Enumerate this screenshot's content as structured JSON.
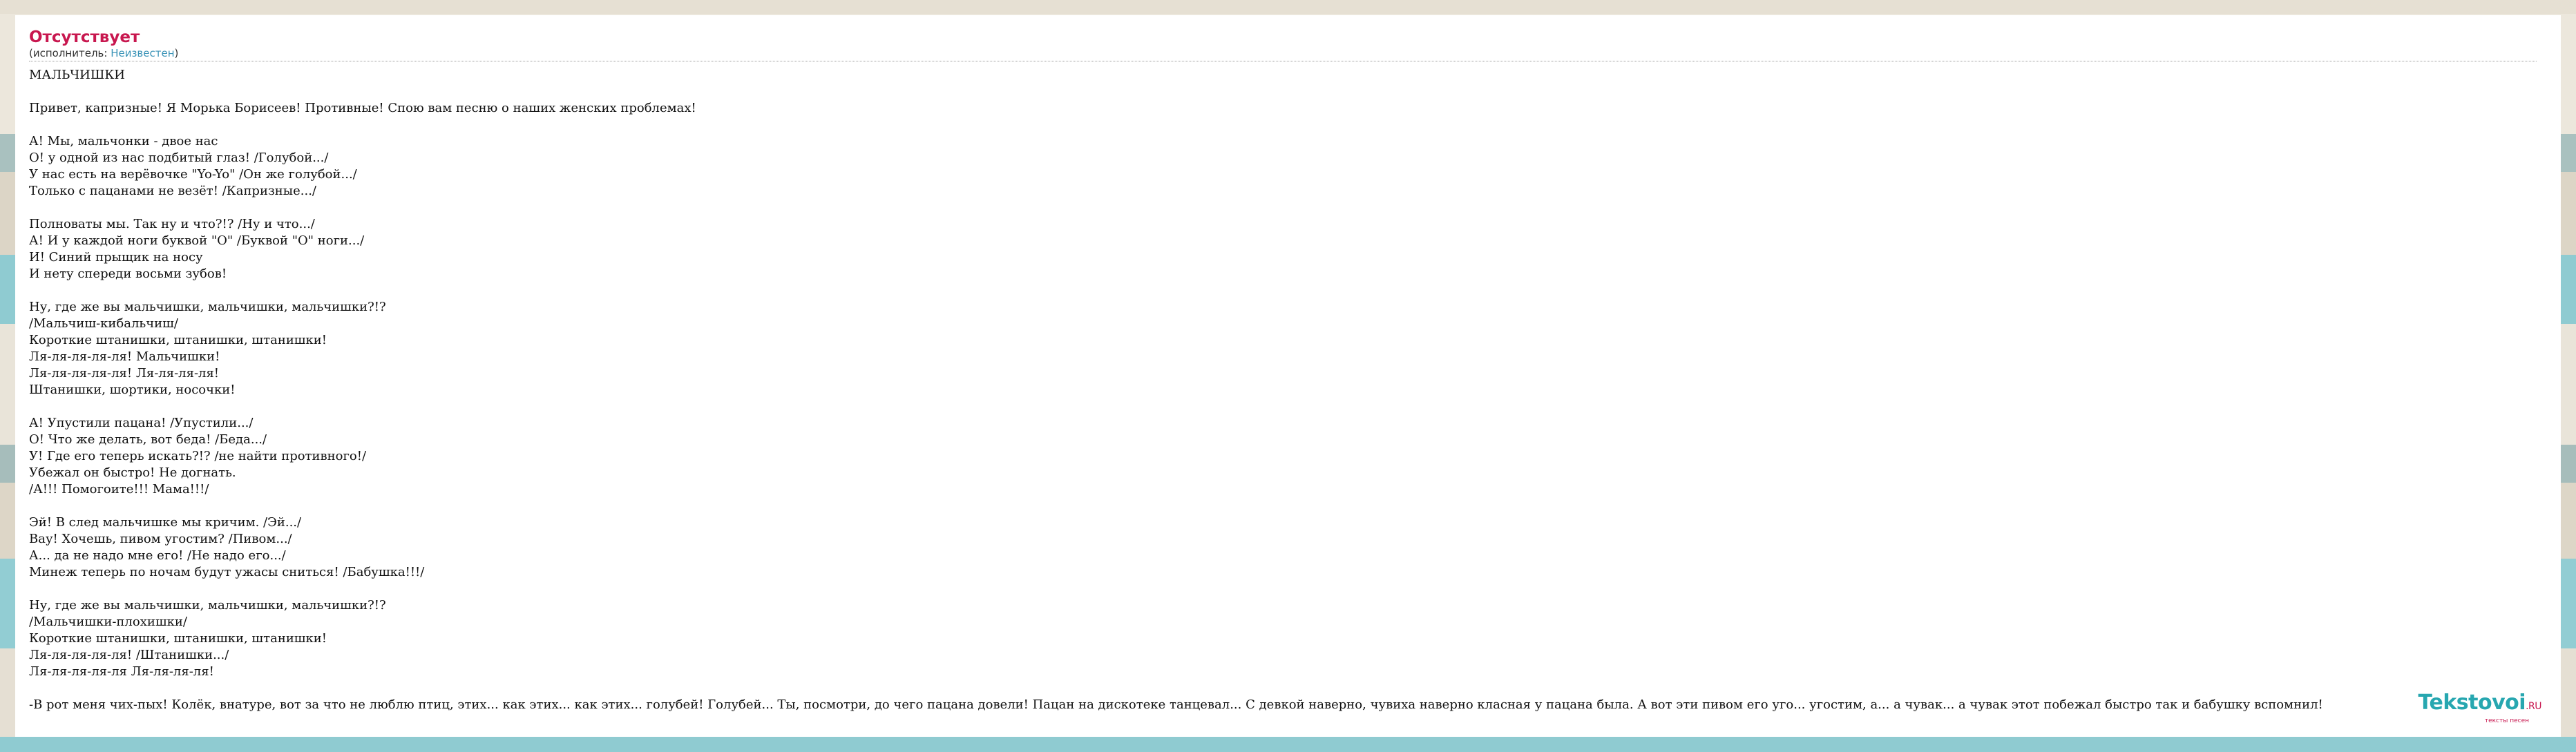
{
  "song": {
    "title": "Отсутствует",
    "artist_prefix": "(исполнитель: ",
    "artist_name": "Неизвестен",
    "artist_suffix": ")"
  },
  "lyrics": [
    "МАЛЬЧИШКИ",
    "",
    "Привет, капризные! Я Морька Борисеев! Противные! Спою вам песню о наших женских проблемах!",
    "",
    "А! Мы, мальчонки - двое нас",
    "О! у одной из нас подбитый глаз! /Голубой...//",
    "У нас есть на верёвочке \"Yo-Yo\" /Он же голубой...//",
    "Только с пацанами не везёт! /Капризные...//",
    "",
    "Полноваты мы. Так ну и что?!? /Ну и что...//",
    "А! И у каждой ноги буквой \"О\" /Буквой \"О\" ноги...//",
    "И! Синий прыщик на носу",
    "И нету спереди восьми зубов!",
    "",
    "Ну, где же вы мальчишки, мальчишки, мальчишки?!?",
    "/Мальчиш-кибальчиш/",
    "Короткие штанишки, штанишки, штанишки!",
    "Ля-ля-ля-ля-ля! Мальчишки!",
    "Ля-ля-ля-ля-ля! Ля-ля-ля-ля!",
    "Штанишки, шортики, носочки!",
    "",
    "А! Упустили пацана! /Упустили...//",
    "О! Что же делать, вот беда! /Беда...//",
    "У! Где его теперь искать?!? /не найти противного!/",
    "Убежал он быстро! Не догнать.",
    "/А!!! Помогоите!!! Мама!!!/",
    "",
    "Эй! В след мальчишке мы кричим. /Эй...//",
    "Вау! Хочешь, пивом угостим? /Пивом...//",
    "А... да не надо мне его! /Не надо его...//",
    "Минеж теперь по ночам будут ужасы сниться! /Бабушка!!!/",
    "",
    "Ну, где же вы мальчишки, мальчишки, мальчишки?!?",
    "/Мальчишки-плохишки/",
    "Короткие штанишки, штанишки, штанишки!",
    "Ля-ля-ля-ля-ля! /Штанишки...//",
    "Ля-ля-ля-ля-ля Ля-ля-ля-ля!",
    "",
    "-В рот меня чих-пых! Колёк, внатуре, вот за что не люблю птиц, этих... как этих... как этих... голубей! Голубей... Ты, посмотри, до чего пацана довели! Пацан на дискотеке танцевал... С девкой наверно, чувиха наверно класная у пацана была. А вот эти пивом его уго... угостим, а... а чувак... а чувак этот побежал быстро так и бабушку вспомнил!"
  ],
  "logo": {
    "name": "Tekstovoi",
    "domain": ".RU",
    "tagline": "тексты песен"
  },
  "colors": {
    "title": "#c8174f",
    "link": "#3a93b7",
    "logo": "#27a7b0"
  }
}
